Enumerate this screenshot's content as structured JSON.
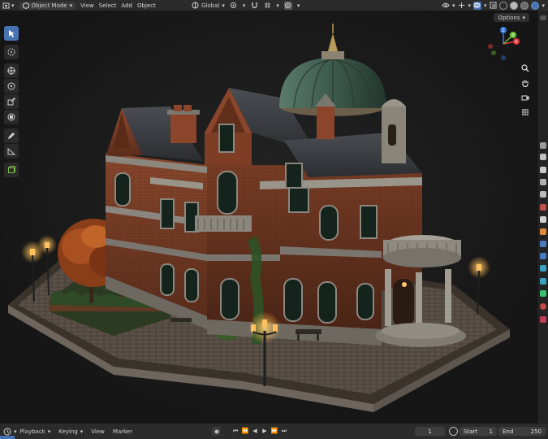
{
  "header": {
    "mode": "Object Mode",
    "menu": [
      "View",
      "Select",
      "Add",
      "Object"
    ],
    "transform_orientation": "Global"
  },
  "viewport": {
    "options_label": "Options"
  },
  "gizmo": {
    "x_label": "X",
    "y_label": "Y",
    "z_label": "Z"
  },
  "timeline": {
    "playback": "Playback",
    "keying": "Keying",
    "view": "View",
    "marker": "Marker",
    "current_frame": "1",
    "start_label": "Start",
    "start_value": "1",
    "end_label": "End",
    "end_value": "250"
  },
  "colors": {
    "accent": "#4772b3",
    "x_axis": "#e03a3a",
    "y_axis": "#6ec23a",
    "z_axis": "#3a7ae0"
  }
}
